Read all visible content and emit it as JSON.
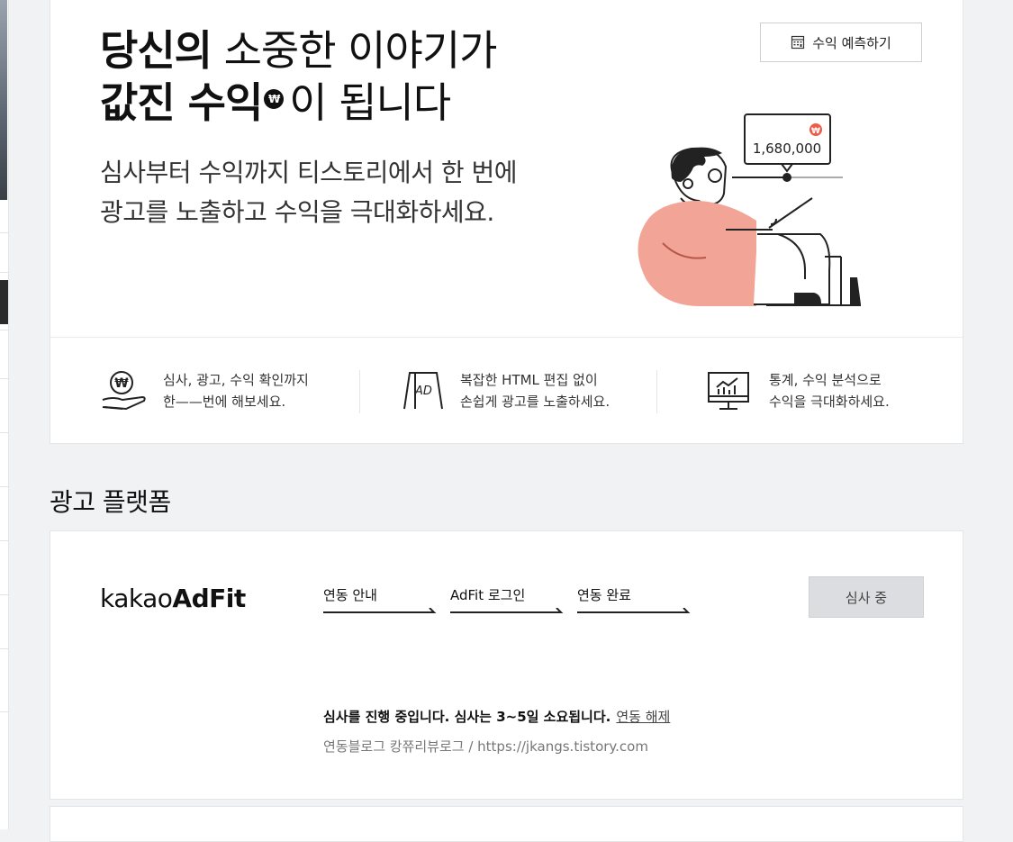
{
  "hero": {
    "title_line1_bold": "당신의",
    "title_line1_rest": " 소중한 이야기가",
    "title_line2_bold": "값진 수익",
    "won_badge": "₩",
    "title_line2_rest": "이 됩니다",
    "subtitle_line1": "심사부터 수익까지 티스토리에서 한 번에",
    "subtitle_line2": "광고를 노출하고 수익을 극대화하세요.",
    "predict_button": "수익 예측하기",
    "illustration": {
      "amount": "1,680,000",
      "won": "₩"
    }
  },
  "features": [
    {
      "icon": "won-hand-icon",
      "line1": "심사, 광고, 수익 확인까지",
      "line2": "한——번에 해보세요."
    },
    {
      "icon": "ad-board-icon",
      "line1": "복잡한 HTML 편집 없이",
      "line2": "손쉽게 광고를 노출하세요.",
      "ad_label": "AD"
    },
    {
      "icon": "stats-monitor-icon",
      "line1": "통계, 수익 분석으로",
      "line2": "수익을 극대화하세요."
    }
  ],
  "platform_section": {
    "title": "광고 플랫폼",
    "logo_light": "kakao",
    "logo_bold": "AdFit",
    "steps": [
      "연동 안내",
      "AdFit 로그인",
      "연동 완료"
    ],
    "status_button": "심사 중",
    "notice": "심사를 진행 중입니다. 심사는 3~5일 소요됩니다.",
    "unlink_link": "연동 해제",
    "blog_info": "연동블로그 캉쮸리뷰로그 / https://jkangs.tistory.com"
  },
  "colors": {
    "background": "#f1f2f4",
    "accent_salmon": "#f2a596",
    "won_red": "#ef5a4a",
    "status_gray": "#dcdde0"
  }
}
